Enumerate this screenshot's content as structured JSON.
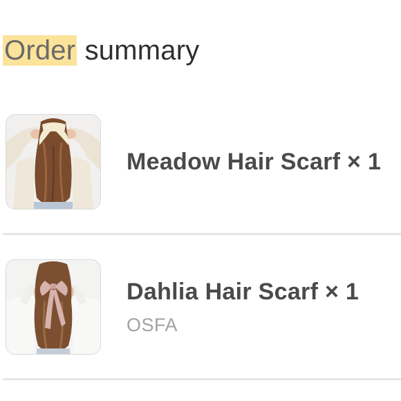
{
  "header": {
    "title_highlight": "Order",
    "title_rest": " summary"
  },
  "items": [
    {
      "name": "Meadow Hair Scarf × 1",
      "variant": "",
      "scarf_color": "#f3ecd2"
    },
    {
      "name": "Dahlia Hair Scarf × 1",
      "variant": "OSFA",
      "scarf_color": "#d7b3ad"
    }
  ],
  "colors": {
    "highlight": "#fbe39a",
    "divider": "#e6e6e6",
    "variant_text": "#a2a2a2"
  }
}
